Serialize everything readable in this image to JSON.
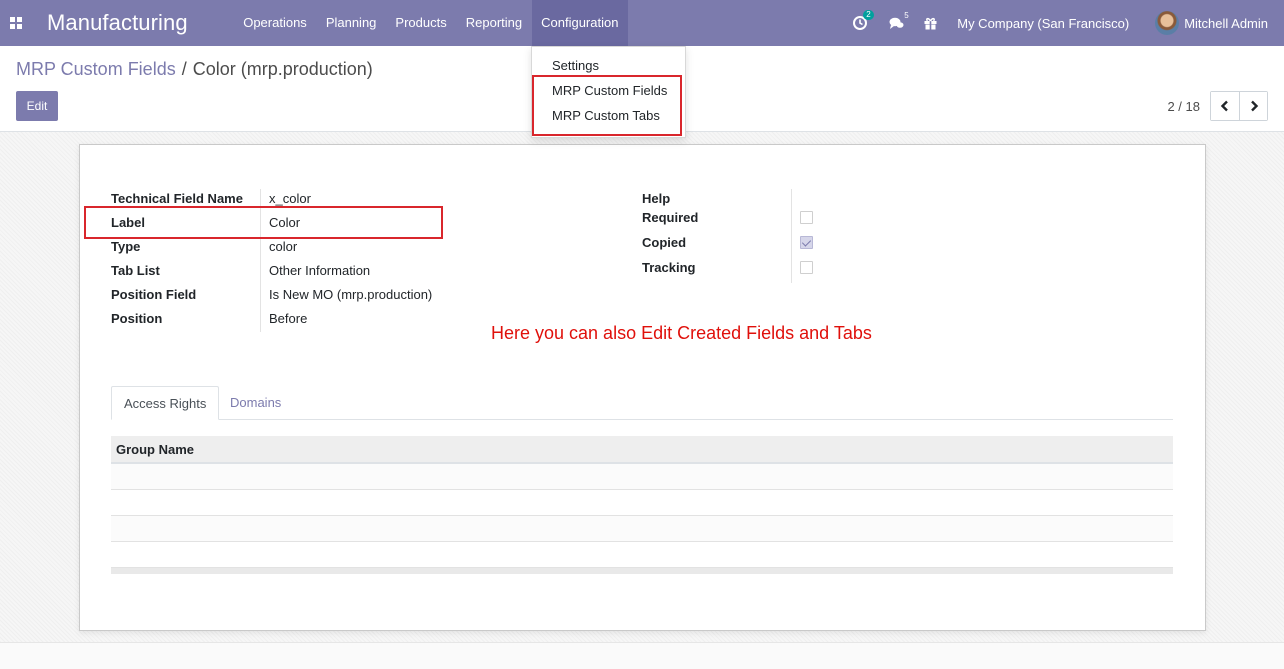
{
  "navbar": {
    "app_title": "Manufacturing",
    "menu": [
      {
        "label": "Operations"
      },
      {
        "label": "Planning"
      },
      {
        "label": "Products"
      },
      {
        "label": "Reporting"
      },
      {
        "label": "Configuration",
        "active": true
      }
    ],
    "activity_count": "2",
    "messages_count": "5",
    "company": "My Company (San Francisco)",
    "user": "Mitchell Admin",
    "color": "#7c7bad"
  },
  "breadcrumb": {
    "parent": "MRP Custom Fields",
    "separator": "/",
    "current": "Color (mrp.production)"
  },
  "toolbar": {
    "edit_label": "Edit"
  },
  "pager": {
    "value": "2 / 18"
  },
  "config_dropdown": {
    "items": [
      {
        "label": "Settings"
      },
      {
        "label": "MRP Custom Fields"
      },
      {
        "label": "MRP Custom Tabs"
      }
    ]
  },
  "form": {
    "left_fields": [
      {
        "label": "Technical Field Name",
        "value": "x_color"
      },
      {
        "label": "Label",
        "value": "Color"
      },
      {
        "label": "Type",
        "value": "color"
      },
      {
        "label": "Tab List",
        "value": "Other Information"
      },
      {
        "label": "Position Field",
        "value": "Is New MO (mrp.production)"
      },
      {
        "label": "Position",
        "value": "Before"
      }
    ],
    "right_fields": [
      {
        "label": "Help"
      },
      {
        "label": "Required",
        "checked": false
      },
      {
        "label": "Copied",
        "checked": true
      },
      {
        "label": "Tracking",
        "checked": false
      }
    ]
  },
  "annotation": "Here you can also Edit Created Fields and Tabs",
  "tabs": [
    {
      "label": "Access Rights",
      "active": true
    },
    {
      "label": "Domains",
      "active": false
    }
  ],
  "table": {
    "column_header": "Group Name"
  },
  "colors": {
    "accent": "#7c7bad",
    "highlight": "#d9262c"
  }
}
